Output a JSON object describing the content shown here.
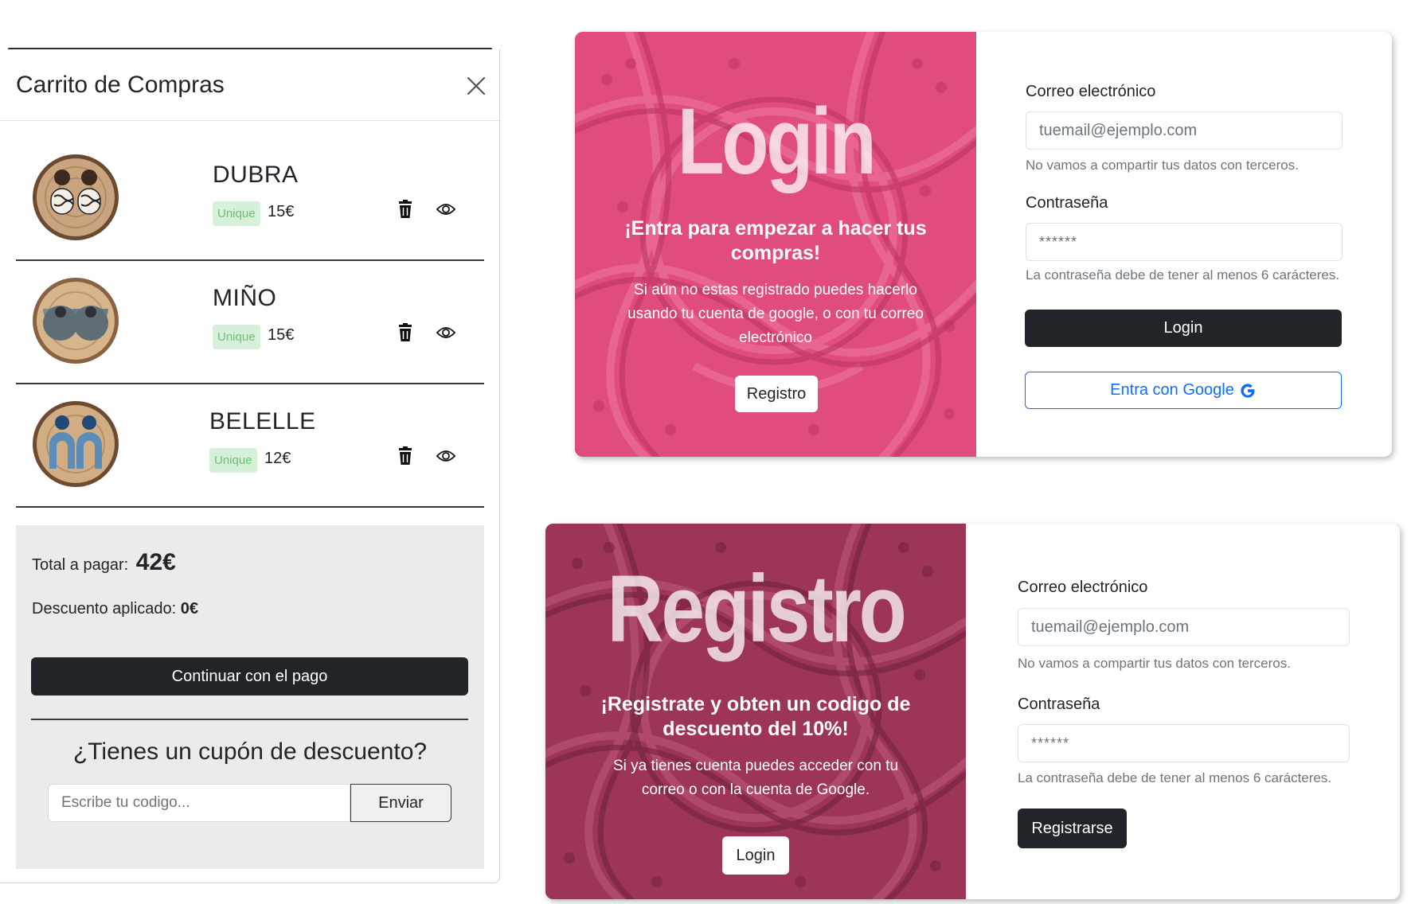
{
  "cart": {
    "title": "Carrito de Compras",
    "items": [
      {
        "name": "DUBRA",
        "badge": "Unique",
        "price": "15€"
      },
      {
        "name": "MIÑO",
        "badge": "Unique",
        "price": "15€"
      },
      {
        "name": "BELELLE",
        "badge": "Unique",
        "price": "12€"
      }
    ],
    "summary": {
      "total_label": "Total a pagar:",
      "total_value": "42€",
      "discount_label": "Descuento aplicado:",
      "discount_value": "0€",
      "pay_label": "Continuar con el pago",
      "coupon_title": "¿Tienes un cupón de descuento?",
      "coupon_placeholder": "Escribe tu codigo...",
      "coupon_send_label": "Enviar"
    }
  },
  "login": {
    "hero_title": "Login",
    "hero_heading": "¡Entra para empezar a hacer tus compras!",
    "hero_text": "Si aún no estas registrado puedes hacerlo usando tu cuenta de google, o con tu correo electrónico",
    "hero_button": "Registro",
    "email_label": "Correo electrónico",
    "email_placeholder": "tuemail@ejemplo.com",
    "email_help": "No vamos a compartir tus datos con terceros.",
    "password_label": "Contraseña",
    "password_value": "******",
    "password_help": "La contraseña debe de tener al menos 6 carácteres.",
    "submit_label": "Login",
    "google_label": "Entra con Google"
  },
  "register": {
    "hero_title": "Registro",
    "hero_heading": "¡Registrate y obten un codigo de descuento del 10%!",
    "hero_text": "Si ya tienes cuenta puedes acceder con tu correo o con la cuenta de Google.",
    "hero_button": "Login",
    "email_label": "Correo electrónico",
    "email_placeholder": "tuemail@ejemplo.com",
    "email_help": "No vamos a compartir tus datos con terceros.",
    "password_label": "Contraseña",
    "password_value": "******",
    "password_help": "La contraseña debe de tener al menos 6 carácteres.",
    "submit_label": "Registrarse"
  },
  "colors": {
    "dark_button": "#212529",
    "primary_blue": "#0d6efd",
    "login_hero": "#e04d7d",
    "register_hero": "#9c3558",
    "badge_green": "#6fbf73"
  }
}
